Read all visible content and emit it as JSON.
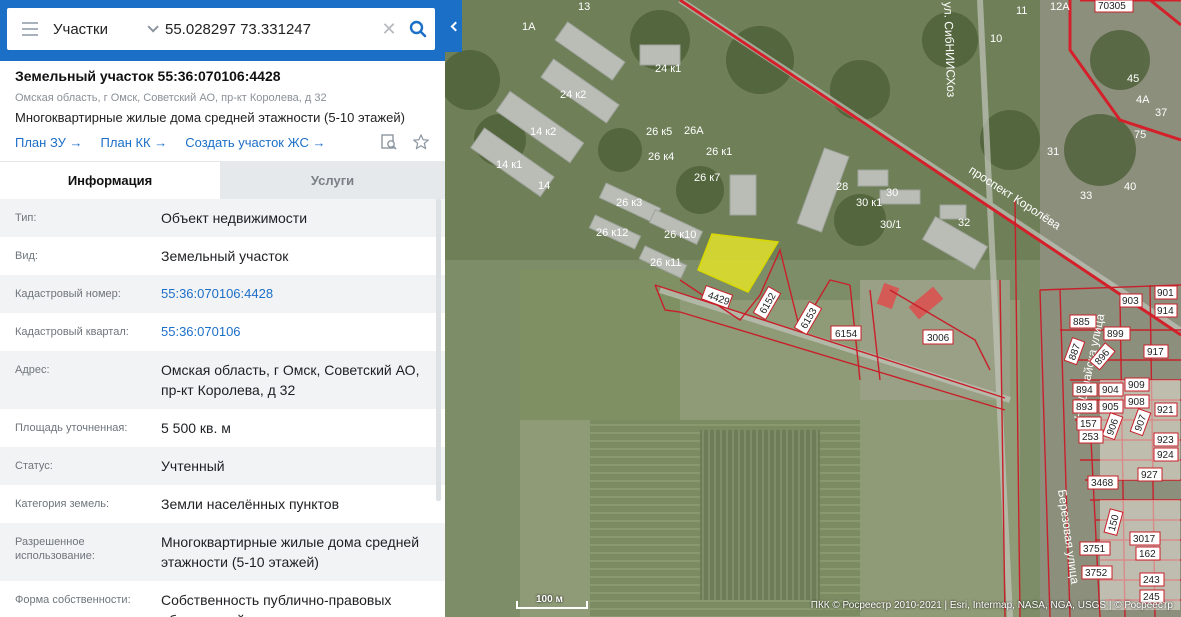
{
  "search": {
    "mode": "Участки",
    "query": "55.028297 73.331247",
    "menu_icon": "hamburger-icon",
    "search_icon": "magnifier-icon",
    "clear_icon": "close-icon"
  },
  "parcel": {
    "title": "Земельный участок 55:36:070106:4428",
    "address": "Омская область, г Омск, Советский АО, пр-кт Королева, д 32",
    "purpose": "Многоквартирные жилые дома средней этажности (5-10 этажей)",
    "links": [
      "План ЗУ →",
      "План КК →",
      "Создать участок ЖС →"
    ]
  },
  "tabs": {
    "info": "Информация",
    "services": "Услуги"
  },
  "info_rows": [
    {
      "label": "Тип:",
      "value": "Объект недвижимости"
    },
    {
      "label": "Вид:",
      "value": "Земельный участок"
    },
    {
      "label": "Кадастровый номер:",
      "value": "55:36:070106:4428"
    },
    {
      "label": "Кадастровый квартал:",
      "value": "55:36:070106"
    },
    {
      "label": "Адрес:",
      "value": "Омская область, г Омск, Советский АО, пр-кт Королева, д 32"
    },
    {
      "label": "Площадь уточненная:",
      "value": "5 500 кв. м"
    },
    {
      "label": "Статус:",
      "value": "Учтенный"
    },
    {
      "label": "Категория земель:",
      "value": "Земли населённых пунктов"
    },
    {
      "label": "Разрешенное использование:",
      "value": "Многоквартирные жилые дома средней этажности (5-10 этажей)"
    },
    {
      "label": "Форма собственности:",
      "value": "Собственность публично-правовых образований"
    }
  ],
  "map": {
    "street_labels": [
      "проспект Королёва",
      "ул. СибНИИСХоз",
      "На Дунайска улица",
      "Березовая улица"
    ],
    "building_labels": [
      "24 к1",
      "24 к2",
      "14 к2",
      "14 к1",
      "14",
      "26 к5",
      "26А",
      "26 к4",
      "26 к1",
      "26 к7",
      "26 к3",
      "26 к12",
      "26 к10",
      "26 к11",
      "28",
      "30",
      "30 к1",
      "30/1",
      "32",
      "31",
      "33",
      "40",
      "45",
      "4А",
      "37",
      "75",
      "12А",
      "11",
      "10",
      "1А",
      "13"
    ],
    "parcel_labels": [
      "4429",
      "6152",
      "6153",
      "6154",
      "3006",
      "885",
      "899",
      "887",
      "896",
      "917",
      "894",
      "904",
      "909",
      "893",
      "905",
      "908",
      "157",
      "906",
      "253",
      "907",
      "923",
      "924",
      "927",
      "3468",
      "150",
      "3017",
      "3751",
      "162",
      "3752",
      "243",
      "245",
      "70305",
      "901",
      "903",
      "914",
      "921"
    ],
    "scale": "100 м",
    "attribution": "ПКК © Росреестр 2010-2021 | Esri, Intermap, NASA, NGA, USGS | © Росреестр"
  }
}
